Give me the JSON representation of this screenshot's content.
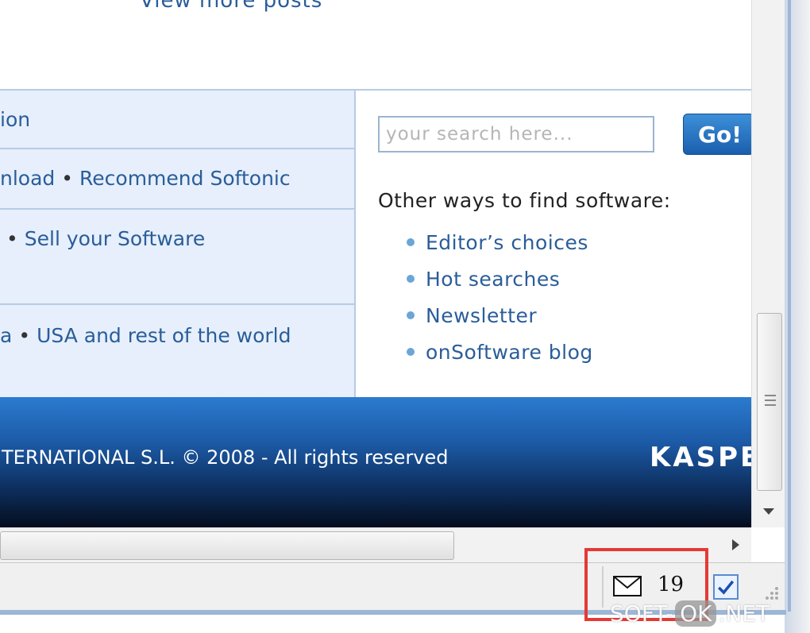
{
  "top_link": "View more posts",
  "left_rows": [
    {
      "parts": [
        "ion"
      ]
    },
    {
      "parts": [
        "nload",
        "Recommend Softonic"
      ]
    },
    {
      "parts": [
        "",
        "Sell your Software"
      ]
    },
    {
      "parts": [
        "a",
        "USA and rest of the world"
      ]
    }
  ],
  "search": {
    "placeholder": "your search here...",
    "button_label": "Go!"
  },
  "other_ways": {
    "title": "Other ways to find software:",
    "links": [
      "Editor’s choices",
      "Hot searches",
      "Newsletter",
      "onSoftware blog"
    ]
  },
  "footer": {
    "copyright": "TERNATIONAL S.L. © 2008 - All rights reserved",
    "logo": "KASPE"
  },
  "statusbar": {
    "mail_count": "19"
  },
  "watermark": {
    "left": "SOFT-",
    "mid": "OK",
    "right": ".NET"
  },
  "colors": {
    "link": "#2a5d9a",
    "highlight": "#e53935",
    "footer_blue": "#1c5aa6"
  }
}
